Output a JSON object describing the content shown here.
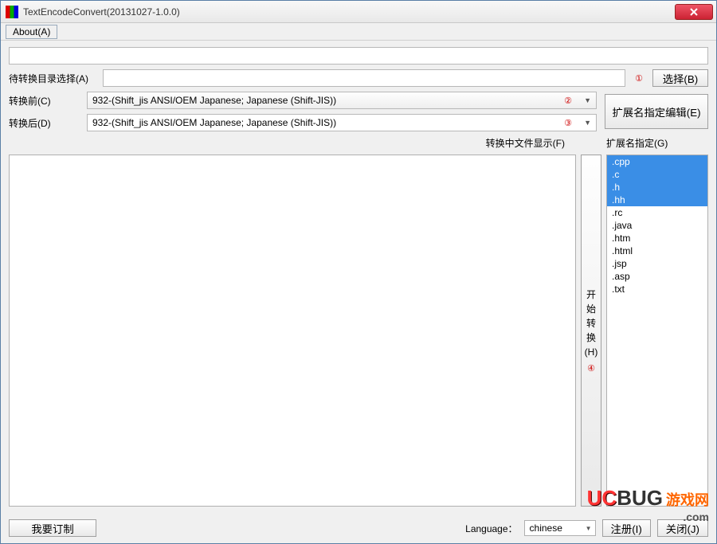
{
  "window": {
    "title": "TextEncodeConvert(20131027-1.0.0)"
  },
  "menu": {
    "about": "About(A)"
  },
  "form": {
    "dir_label": "待转换目录选择(A)",
    "dir_value": "",
    "marker1": "①",
    "select_btn": "选择(B)",
    "before_label": "转换前(C)",
    "before_value": "932-(Shift_jis ANSI/OEM Japanese; Japanese (Shift-JIS))",
    "marker2": "②",
    "after_label": "转换后(D)",
    "after_value": "932-(Shift_jis ANSI/OEM Japanese; Japanese (Shift-JIS))",
    "marker3": "③",
    "ext_edit_btn": "扩展名指定编辑(E)"
  },
  "lists": {
    "files_label": "转换中文件显示(F)",
    "ext_label": "扩展名指定(G)",
    "extensions": [
      {
        "text": ".cpp",
        "selected": true
      },
      {
        "text": ".c",
        "selected": true
      },
      {
        "text": ".h",
        "selected": true
      },
      {
        "text": ".hh",
        "selected": true
      },
      {
        "text": ".rc",
        "selected": false
      },
      {
        "text": ".java",
        "selected": false
      },
      {
        "text": ".htm",
        "selected": false
      },
      {
        "text": ".html",
        "selected": false
      },
      {
        "text": ".jsp",
        "selected": false
      },
      {
        "text": ".asp",
        "selected": false
      },
      {
        "text": ".txt",
        "selected": false
      }
    ]
  },
  "convert": {
    "c1": "开",
    "c2": "始",
    "c3": "转",
    "c4": "换",
    "hk": "(H)",
    "marker4": "④"
  },
  "bottom": {
    "custom_btn": "我要订制",
    "language_label": "Language：",
    "language_value": "chinese",
    "register_btn": "注册(I)",
    "hidden_btn": "关闭(J)"
  },
  "watermark": {
    "uc": "UC",
    "bug": "BUG",
    "tag": "游戏网",
    "com": ".com"
  }
}
